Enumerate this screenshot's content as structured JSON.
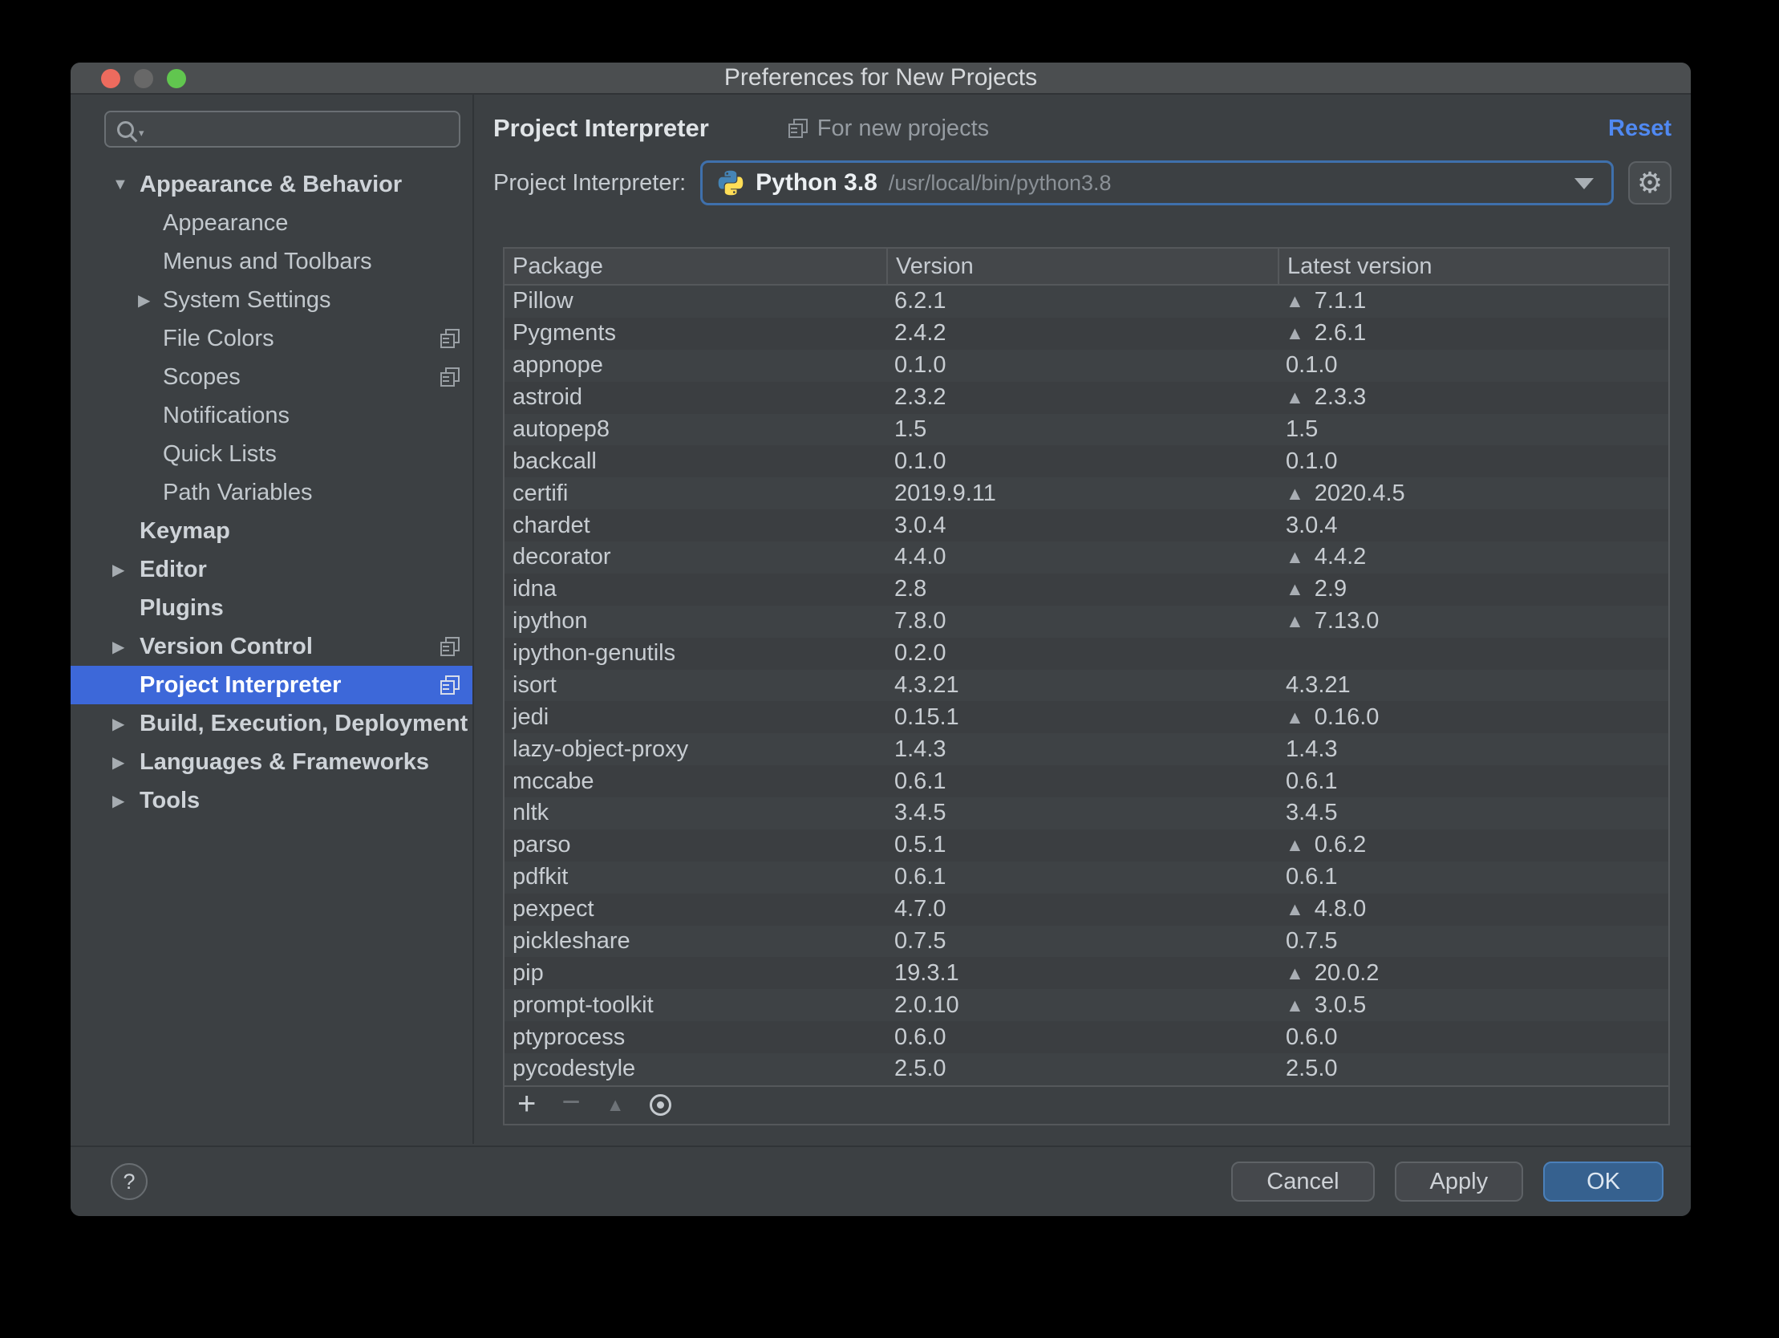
{
  "window": {
    "title": "Preferences for New Projects"
  },
  "traffic_lights": {
    "close": "#ed6b5e",
    "minimize": "#686868",
    "zoom": "#61c64f"
  },
  "search": {
    "value": "",
    "placeholder": ""
  },
  "sidebar": {
    "items": [
      {
        "label": "Appearance & Behavior",
        "level": "top",
        "bold": true,
        "arrow": "down",
        "dup_icon": false,
        "selected": false
      },
      {
        "label": "Appearance",
        "level": "child",
        "bold": false,
        "arrow": null,
        "dup_icon": false,
        "selected": false
      },
      {
        "label": "Menus and Toolbars",
        "level": "child",
        "bold": false,
        "arrow": null,
        "dup_icon": false,
        "selected": false
      },
      {
        "label": "System Settings",
        "level": "child",
        "bold": false,
        "arrow": "right",
        "dup_icon": false,
        "selected": false
      },
      {
        "label": "File Colors",
        "level": "child",
        "bold": false,
        "arrow": null,
        "dup_icon": true,
        "selected": false
      },
      {
        "label": "Scopes",
        "level": "child",
        "bold": false,
        "arrow": null,
        "dup_icon": true,
        "selected": false
      },
      {
        "label": "Notifications",
        "level": "child",
        "bold": false,
        "arrow": null,
        "dup_icon": false,
        "selected": false
      },
      {
        "label": "Quick Lists",
        "level": "child",
        "bold": false,
        "arrow": null,
        "dup_icon": false,
        "selected": false
      },
      {
        "label": "Path Variables",
        "level": "child",
        "bold": false,
        "arrow": null,
        "dup_icon": false,
        "selected": false
      },
      {
        "label": "Keymap",
        "level": "top",
        "bold": true,
        "arrow": null,
        "dup_icon": false,
        "selected": false
      },
      {
        "label": "Editor",
        "level": "top",
        "bold": true,
        "arrow": "right",
        "dup_icon": false,
        "selected": false
      },
      {
        "label": "Plugins",
        "level": "top",
        "bold": true,
        "arrow": null,
        "dup_icon": false,
        "selected": false
      },
      {
        "label": "Version Control",
        "level": "top",
        "bold": true,
        "arrow": "right",
        "dup_icon": true,
        "selected": false
      },
      {
        "label": "Project Interpreter",
        "level": "top",
        "bold": true,
        "arrow": null,
        "dup_icon": true,
        "selected": true
      },
      {
        "label": "Build, Execution, Deployment",
        "level": "top",
        "bold": true,
        "arrow": "right",
        "dup_icon": false,
        "selected": false
      },
      {
        "label": "Languages & Frameworks",
        "level": "top",
        "bold": true,
        "arrow": "right",
        "dup_icon": false,
        "selected": false
      },
      {
        "label": "Tools",
        "level": "top",
        "bold": true,
        "arrow": "right",
        "dup_icon": false,
        "selected": false
      }
    ]
  },
  "header": {
    "title": "Project Interpreter",
    "scope_label": "For new projects",
    "reset_label": "Reset",
    "reset_color": "#5089f2"
  },
  "interpreter": {
    "label": "Project Interpreter:",
    "name": "Python 3.8",
    "path": "/usr/local/bin/python3.8",
    "focus_border_color": "#3f70ac"
  },
  "table": {
    "columns": [
      "Package",
      "Version",
      "Latest version"
    ],
    "rows": [
      {
        "package": "Pillow",
        "version": "6.2.1",
        "latest": "7.1.1",
        "upgrade": true
      },
      {
        "package": "Pygments",
        "version": "2.4.2",
        "latest": "2.6.1",
        "upgrade": true
      },
      {
        "package": "appnope",
        "version": "0.1.0",
        "latest": "0.1.0",
        "upgrade": false
      },
      {
        "package": "astroid",
        "version": "2.3.2",
        "latest": "2.3.3",
        "upgrade": true
      },
      {
        "package": "autopep8",
        "version": "1.5",
        "latest": "1.5",
        "upgrade": false
      },
      {
        "package": "backcall",
        "version": "0.1.0",
        "latest": "0.1.0",
        "upgrade": false
      },
      {
        "package": "certifi",
        "version": "2019.9.11",
        "latest": "2020.4.5",
        "upgrade": true
      },
      {
        "package": "chardet",
        "version": "3.0.4",
        "latest": "3.0.4",
        "upgrade": false
      },
      {
        "package": "decorator",
        "version": "4.4.0",
        "latest": "4.4.2",
        "upgrade": true
      },
      {
        "package": "idna",
        "version": "2.8",
        "latest": "2.9",
        "upgrade": true
      },
      {
        "package": "ipython",
        "version": "7.8.0",
        "latest": "7.13.0",
        "upgrade": true
      },
      {
        "package": "ipython-genutils",
        "version": "0.2.0",
        "latest": "",
        "upgrade": false
      },
      {
        "package": "isort",
        "version": "4.3.21",
        "latest": "4.3.21",
        "upgrade": false
      },
      {
        "package": "jedi",
        "version": "0.15.1",
        "latest": "0.16.0",
        "upgrade": true
      },
      {
        "package": "lazy-object-proxy",
        "version": "1.4.3",
        "latest": "1.4.3",
        "upgrade": false
      },
      {
        "package": "mccabe",
        "version": "0.6.1",
        "latest": "0.6.1",
        "upgrade": false
      },
      {
        "package": "nltk",
        "version": "3.4.5",
        "latest": "3.4.5",
        "upgrade": false
      },
      {
        "package": "parso",
        "version": "0.5.1",
        "latest": "0.6.2",
        "upgrade": true
      },
      {
        "package": "pdfkit",
        "version": "0.6.1",
        "latest": "0.6.1",
        "upgrade": false
      },
      {
        "package": "pexpect",
        "version": "4.7.0",
        "latest": "4.8.0",
        "upgrade": true
      },
      {
        "package": "pickleshare",
        "version": "0.7.5",
        "latest": "0.7.5",
        "upgrade": false
      },
      {
        "package": "pip",
        "version": "19.3.1",
        "latest": "20.0.2",
        "upgrade": true
      },
      {
        "package": "prompt-toolkit",
        "version": "2.0.10",
        "latest": "3.0.5",
        "upgrade": true
      },
      {
        "package": "ptyprocess",
        "version": "0.6.0",
        "latest": "0.6.0",
        "upgrade": false
      },
      {
        "package": "pycodestyle",
        "version": "2.5.0",
        "latest": "2.5.0",
        "upgrade": false
      }
    ],
    "toolbar_icons": [
      "install-package",
      "uninstall-package",
      "upgrade-package",
      "show-early-releases"
    ]
  },
  "footer": {
    "help_label": "?",
    "cancel_label": "Cancel",
    "apply_label": "Apply",
    "ok_label": "OK",
    "ok_color": "#36618f"
  }
}
